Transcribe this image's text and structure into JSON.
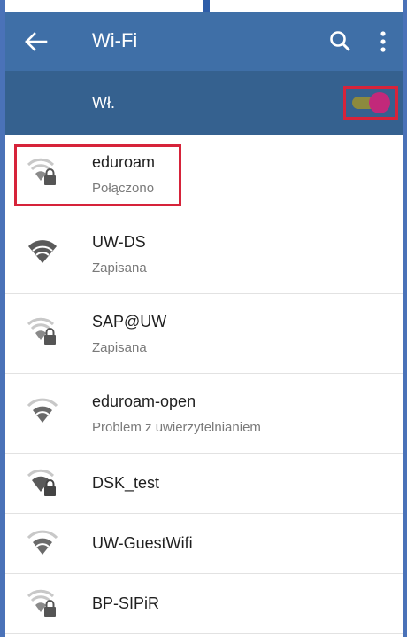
{
  "appbar": {
    "title": "Wi-Fi",
    "back_icon": "arrow-back-icon",
    "search_icon": "search-icon",
    "more_icon": "more-vert-icon"
  },
  "master_switch": {
    "label": "Wł.",
    "state": "on"
  },
  "colors": {
    "appbar": "#3f6fa7",
    "switchbar": "#35618f",
    "toggle_thumb": "#c2297a",
    "highlight": "#d6233a"
  },
  "networks": [
    {
      "name": "eduroam",
      "status": "Połączono",
      "secured": true,
      "signal": "weak"
    },
    {
      "name": "UW-DS",
      "status": "Zapisana",
      "secured": false,
      "signal": "full"
    },
    {
      "name": "SAP@UW",
      "status": "Zapisana",
      "secured": true,
      "signal": "weak"
    },
    {
      "name": "eduroam-open",
      "status": "Problem z uwierzytelnianiem",
      "secured": false,
      "signal": "medium"
    },
    {
      "name": "DSK_test",
      "status": "",
      "secured": true,
      "signal": "medium"
    },
    {
      "name": "UW-GuestWifi",
      "status": "",
      "secured": false,
      "signal": "medium"
    },
    {
      "name": "BP-SIPiR",
      "status": "",
      "secured": true,
      "signal": "weak"
    }
  ]
}
